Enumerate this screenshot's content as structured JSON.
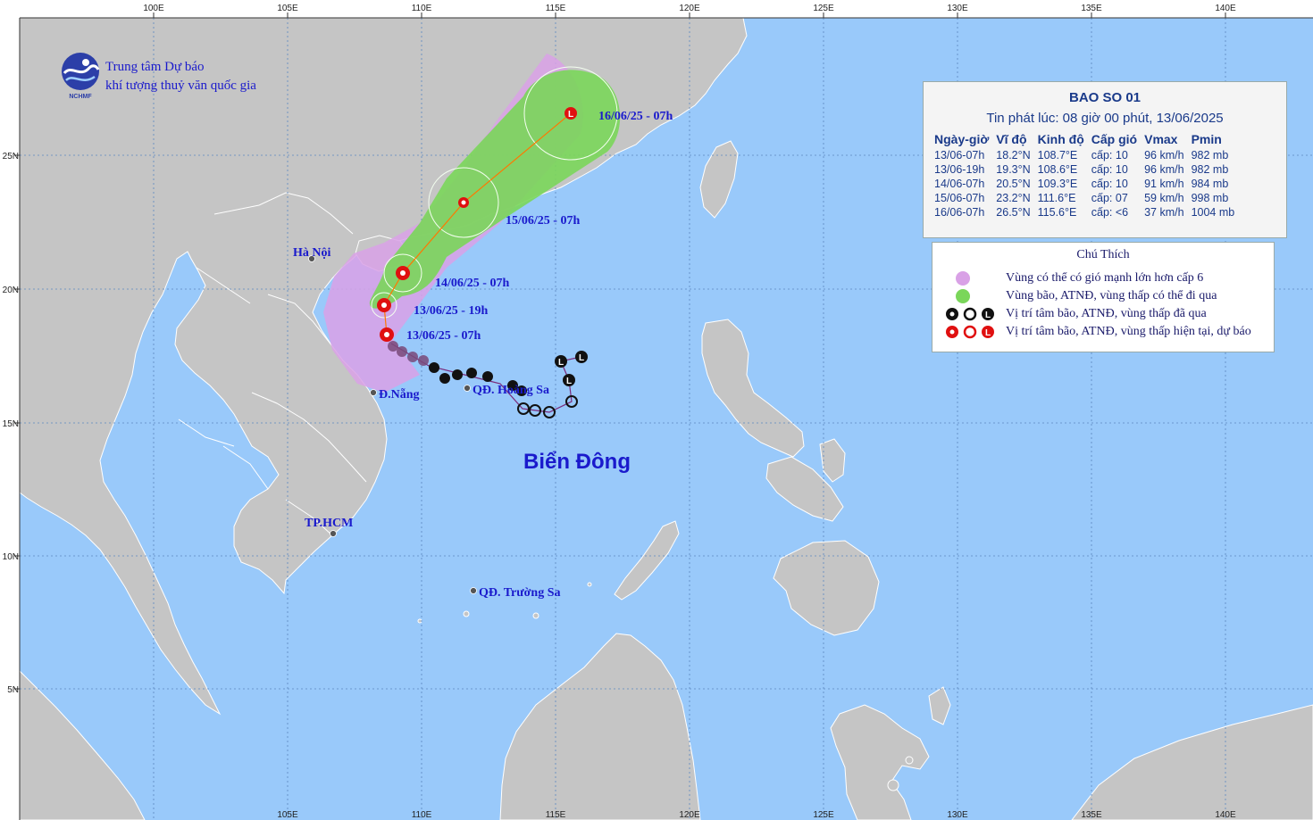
{
  "map": {
    "agency_line1": "Trung tâm Dự báo",
    "agency_line2": "khí tượng thuỷ văn quốc gia",
    "logo_text": "NCHMF",
    "sea_label": "Biển Đông",
    "lon_top": [
      "100E",
      "105E",
      "110E",
      "115E",
      "120E",
      "125E",
      "130E",
      "135E",
      "140E"
    ],
    "lon_bottom": [
      "105E",
      "110E",
      "115E",
      "120E",
      "125E",
      "130E",
      "135E",
      "140E"
    ],
    "lat_labels": [
      "25N",
      "20N",
      "15N",
      "10N",
      "5N"
    ],
    "places": [
      {
        "key": "hanoi",
        "name": "Hà Nội"
      },
      {
        "key": "danang",
        "name": "Đ.Nẵng"
      },
      {
        "key": "hoangsa",
        "name": "QĐ. Hoàng Sa"
      },
      {
        "key": "hcm",
        "name": "TP.HCM"
      },
      {
        "key": "truongsa",
        "name": "QĐ. Trường Sa"
      }
    ],
    "forecast_labels": [
      "13/06/25 - 07h",
      "13/06/25 - 19h",
      "14/06/25 - 07h",
      "15/06/25 - 07h",
      "16/06/25 - 07h"
    ],
    "colors": {
      "sea": "#99c9fa",
      "land": "#c5c5c5",
      "coast": "#ffffff",
      "grid": "#5b87c0",
      "risk_zone": "#d9a1e6",
      "storm_zone": "#7ad65a",
      "current_forecast": "#e01010",
      "past_track": "#111111",
      "label": "#1a1acc",
      "forecast_line": "#ff7700"
    }
  },
  "bulletin": {
    "title": "BAO SO 01",
    "issued": "Tin phát lúc: 08 giờ 00 phút, 13/06/2025",
    "headers": [
      "Ngày-giờ",
      "Vĩ độ",
      "Kinh độ",
      "Cấp gió",
      "Vmax",
      "Pmin"
    ],
    "rows": [
      [
        "13/06-07h",
        "18.2°N",
        "108.7°E",
        "cấp: 10",
        "96 km/h",
        "982 mb"
      ],
      [
        "13/06-19h",
        "19.3°N",
        "108.6°E",
        "cấp: 10",
        "96 km/h",
        "982 mb"
      ],
      [
        "14/06-07h",
        "20.5°N",
        "109.3°E",
        "cấp: 10",
        "91 km/h",
        "984 mb"
      ],
      [
        "15/06-07h",
        "23.2°N",
        "111.6°E",
        "cấp: 07",
        "59 km/h",
        "998 mb"
      ],
      [
        "16/06-07h",
        "26.5°N",
        "115.6°E",
        "cấp: <6",
        "37 km/h",
        "1004 mb"
      ]
    ]
  },
  "legend": {
    "title": "Chú Thích",
    "items": [
      {
        "text": "Vùng có thể có gió mạnh lớn hơn cấp 6",
        "symbol": "risk-zone-swatch"
      },
      {
        "text": "Vùng bão, ATNĐ, vùng thấp có thể đi qua",
        "symbol": "storm-zone-swatch"
      },
      {
        "text": "Vị trí tâm bão, ATNĐ, vùng thấp đã qua",
        "symbol": "past-symbols"
      },
      {
        "text": "Vị trí tâm bão, ATNĐ, vùng thấp hiện tại, dự báo",
        "symbol": "forecast-symbols"
      }
    ]
  }
}
